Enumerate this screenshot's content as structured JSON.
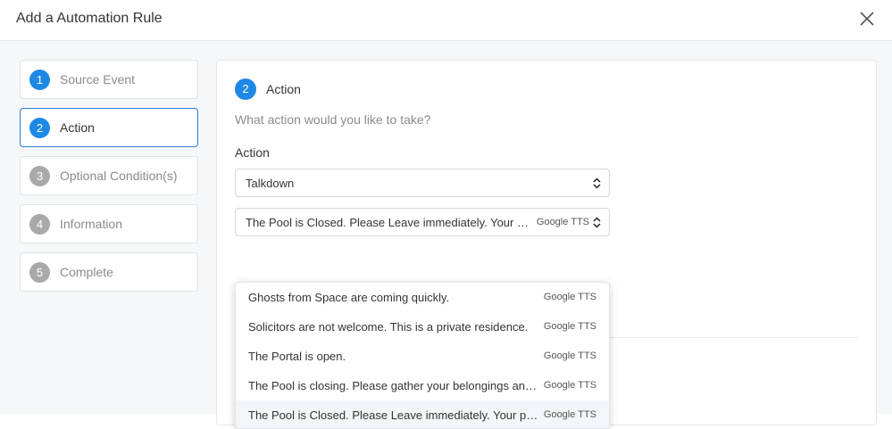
{
  "header": {
    "title": "Add a Automation Rule"
  },
  "steps": [
    {
      "number": "1",
      "label": "Source Event"
    },
    {
      "number": "2",
      "label": "Action"
    },
    {
      "number": "3",
      "label": "Optional Condition(s)"
    },
    {
      "number": "4",
      "label": "Information"
    },
    {
      "number": "5",
      "label": "Complete"
    }
  ],
  "panel": {
    "number": "2",
    "title": "Action",
    "subtitle": "What action would you like to take?",
    "action_label": "Action",
    "action_select": {
      "value": "Talkdown"
    },
    "message_select": {
      "value": "The Pool is Closed. Please Leave immediately. Your presence has been recorded.",
      "tag": "Google TTS"
    }
  },
  "dropdown": {
    "options": [
      {
        "text": "Ghosts from Space are coming quickly.",
        "tag": "Google TTS"
      },
      {
        "text": "Solicitors are not welcome. This is a private residence.",
        "tag": "Google TTS"
      },
      {
        "text": "The Portal is open.",
        "tag": "Google TTS"
      },
      {
        "text": "The Pool is closing. Please gather your belongings and leave.",
        "tag": "Google TTS"
      },
      {
        "text": "The Pool is Closed. Please Leave immediately. Your presence has been recorded.",
        "tag": "Google TTS"
      }
    ]
  },
  "colors": {
    "accent": "#1e88e5",
    "inactive_step": "#a9a9a9",
    "active_border": "#2a7fd4"
  },
  "icons": {
    "close": "close-icon",
    "select": "updown-chevron-icon"
  }
}
